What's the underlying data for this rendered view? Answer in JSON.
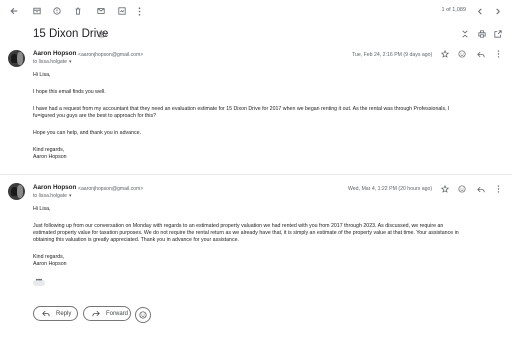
{
  "toolbar": {
    "pager": "1 of 1,089",
    "icons": [
      "back-arrow-icon",
      "archive-icon",
      "report-spam-icon",
      "delete-icon",
      "mark-unread-icon",
      "snooze-icon",
      "more-vert-icon",
      "prev-icon",
      "next-icon"
    ]
  },
  "thread": {
    "subject": "15 Dixon Drive"
  },
  "messages": [
    {
      "sender": "Aaron Hopson",
      "email": "<aaronjhopson@gmail.com>",
      "to": "to lissa.holgate",
      "date": "Tue, Feb 24, 2:16 PM (9 days ago)",
      "greeting": "Hi Lisa,",
      "p1": "I hope this email finds you well.",
      "p2a": "I have had a request from my accountant that they need an evaluation estimate for 15 Dixon Drive for 2017 when we began renting it out. As the rental was through Professionals, I",
      "p2b": "fu=igured you guys are the best to approach for this?",
      "p3": "Hope you can help, and thank you in advance.",
      "sign1": "Kind regards,",
      "sign2": "Aaron Hopson"
    },
    {
      "sender": "Aaron Hopson",
      "email": "<aaronjhopson@gmail.com>",
      "to": "to lissa.holgate",
      "date": "Wed, Mar 4, 1:22 PM (20 hours ago)",
      "greeting": "Hi Lisa,",
      "p1a": "Just following up from our conversation on Monday with regards to an estimated property valuation we had rented with you from 2017 through 2023. As discussed, we require an",
      "p1b": "estimated property value for taxation purposes. We do not require the rental return as we already have that, it is simply an estimate of the property value at that time. Your assistance in",
      "p1c": "obtaining this valuation is greatly appreciated. Thank you in advance for your assistance.",
      "sign1": "Kind regards,",
      "sign2": "Aaron Hopson"
    }
  ],
  "actions": {
    "reply": "Reply",
    "forward": "Forward"
  }
}
